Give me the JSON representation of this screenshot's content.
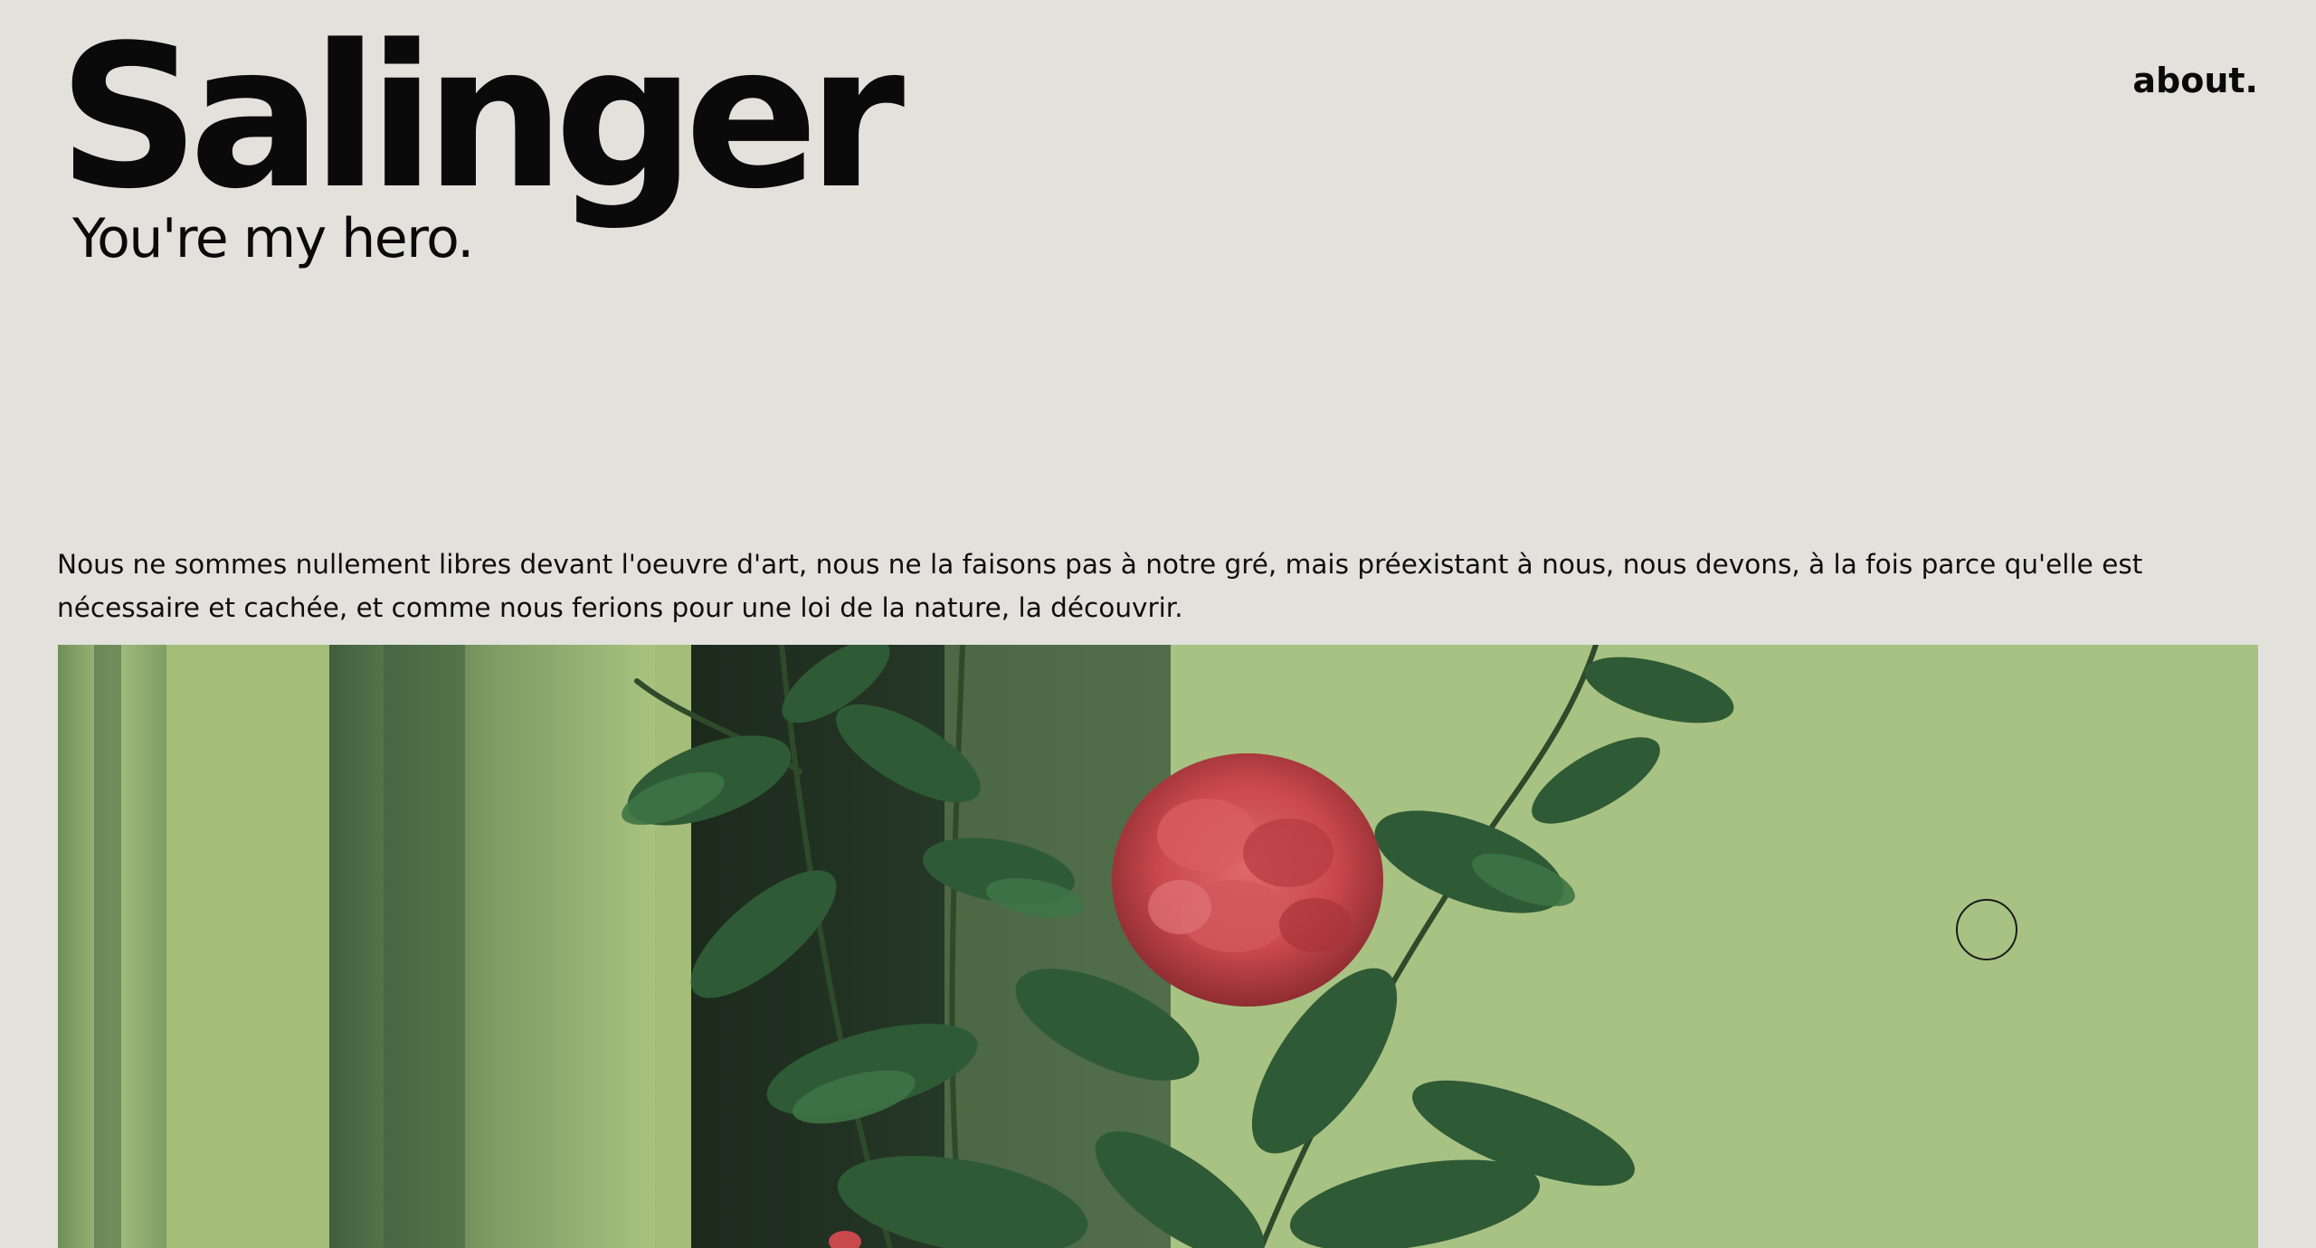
{
  "header": {
    "title": "Salinger",
    "tagline": "You're my hero.",
    "nav_about": "about."
  },
  "main": {
    "intro_text": "Nous ne sommes nullement libres devant l'oeuvre d'art, nous ne la faisons pas à notre gré, mais préexistant à nous, nous devons, à la fois parce qu'elle est nécessaire et cachée, et comme nous ferions pour une loi de la nature, la découvrir.",
    "hero_image": {
      "subject": "red camellia flower with dark green leaves against pale green wall"
    }
  },
  "colors": {
    "background": "#e2e1dc",
    "text": "#0a0a0a",
    "photo_green": "#a6c17d",
    "leaf_green": "#2f5a36",
    "flower_red": "#c9484c"
  },
  "cursor": {
    "icon": "cursor-ring-icon"
  }
}
